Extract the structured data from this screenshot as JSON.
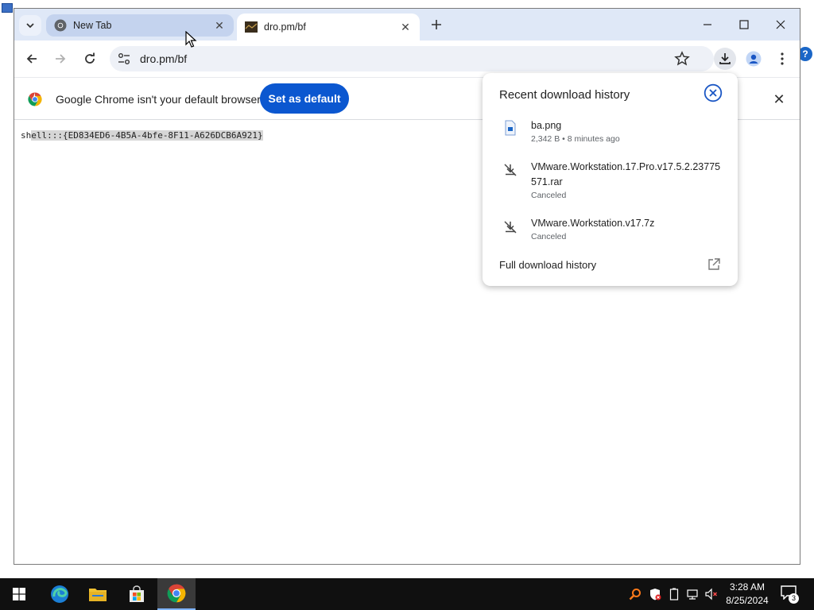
{
  "browser": {
    "tabs": [
      {
        "title": "New Tab",
        "icon": "chrome-icon",
        "active": false
      },
      {
        "title": "dro.pm/bf",
        "icon": "site-favicon",
        "active": true
      }
    ],
    "url": "dro.pm/bf"
  },
  "infobar": {
    "message": "Google Chrome isn't your default browser",
    "button": "Set as default"
  },
  "page": {
    "text_prefix": "sh",
    "text_selected": "ell:::{ED834ED6-4B5A-4bfe-8F11-A626DCB6A921}"
  },
  "downloads": {
    "title": "Recent download history",
    "items": [
      {
        "name": "ba.png",
        "status": "2,342 B • 8 minutes ago",
        "icon": "image-file-icon"
      },
      {
        "name": "VMware.Workstation.17.Pro.v17.5.2.23775571.rar",
        "status": "Canceled",
        "icon": "download-cancelled-icon"
      },
      {
        "name": "VMware.Workstation.v17.7z",
        "status": "Canceled",
        "icon": "download-cancelled-icon"
      }
    ],
    "full_history": "Full download history"
  },
  "taskbar": {
    "apps": [
      "edge-icon",
      "file-explorer-icon",
      "microsoft-store-icon",
      "chrome-icon"
    ],
    "time": "3:28 AM",
    "date": "8/25/2024",
    "notification_count": "3"
  },
  "colors": {
    "accent": "#0b57d0",
    "tabstrip": "#dfe8f7",
    "taskbar": "#101010"
  }
}
